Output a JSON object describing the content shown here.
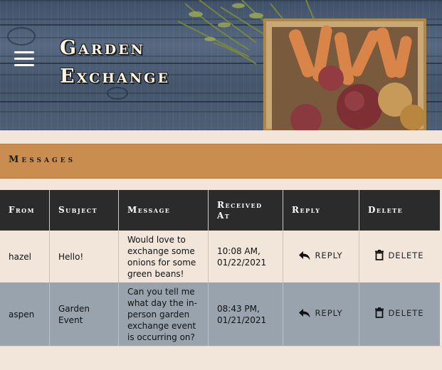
{
  "header": {
    "title_line1": "Garden",
    "title_line2": "Exchange",
    "menu_icon": "hamburger-icon"
  },
  "section": {
    "title": "Messages"
  },
  "table": {
    "columns": [
      "From",
      "Subject",
      "Message",
      "Received At",
      "Reply",
      "Delete"
    ],
    "rows": [
      {
        "from": "hazel",
        "subject": "Hello!",
        "message": "Would love to exchange some onions for some green beans!",
        "received": "10:08 AM, 01/22/2021",
        "reply_label": "REPLY",
        "delete_label": "DELETE"
      },
      {
        "from": "aspen",
        "subject": "Garden Event",
        "message": "Can you tell me what day the in-person garden exchange event is occurring on?",
        "received": "08:43 PM, 01/21/2021",
        "reply_label": "REPLY",
        "delete_label": "DELETE"
      }
    ]
  },
  "colors": {
    "header_wood": "#4e5f75",
    "bar_accent": "#c98d4f",
    "table_header": "#2b2b2b",
    "row_alt": "#98a3ad",
    "page_bg": "#f2e6da"
  },
  "icons": {
    "reply": "reply-arrow-icon",
    "delete": "trash-icon"
  }
}
